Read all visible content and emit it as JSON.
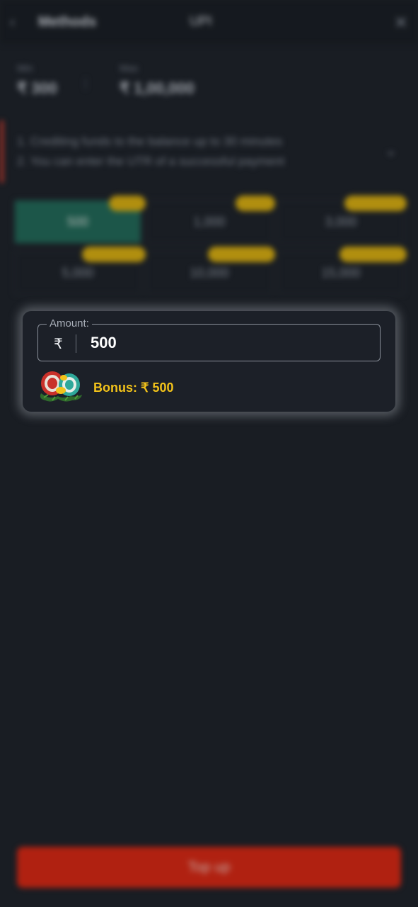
{
  "header": {
    "back_icon": "chevron-left-icon",
    "methods_label": "Methods",
    "method_title": "UPI",
    "close_icon": "close-icon"
  },
  "limits": {
    "min_label": "Min",
    "min_value": "₹ 300",
    "max_label": "Max",
    "max_value": "₹ 1,00,000"
  },
  "info": {
    "line1": "1. Crediting funds to the balance up to 30 minutes",
    "line2": "2. You can enter the UTR of a successful payment",
    "chevron_icon": "chevron-down-icon",
    "accent_color": "#d53a2a"
  },
  "presets": [
    {
      "amount": "500",
      "selected": true
    },
    {
      "amount": "1,000",
      "selected": false
    },
    {
      "amount": "3,000",
      "selected": false
    },
    {
      "amount": "5,000",
      "selected": false
    },
    {
      "amount": "10,000",
      "selected": false
    },
    {
      "amount": "15,000",
      "selected": false
    }
  ],
  "card": {
    "amount_label": "Amount:",
    "currency_symbol": "₹",
    "amount_value": "500",
    "bonus_icon": "gift-chips-icon",
    "bonus_text": "Bonus: ₹ 500",
    "bonus_color": "#f2c21a"
  },
  "footer": {
    "topup_label": "Top up",
    "topup_color": "#e5250e"
  }
}
